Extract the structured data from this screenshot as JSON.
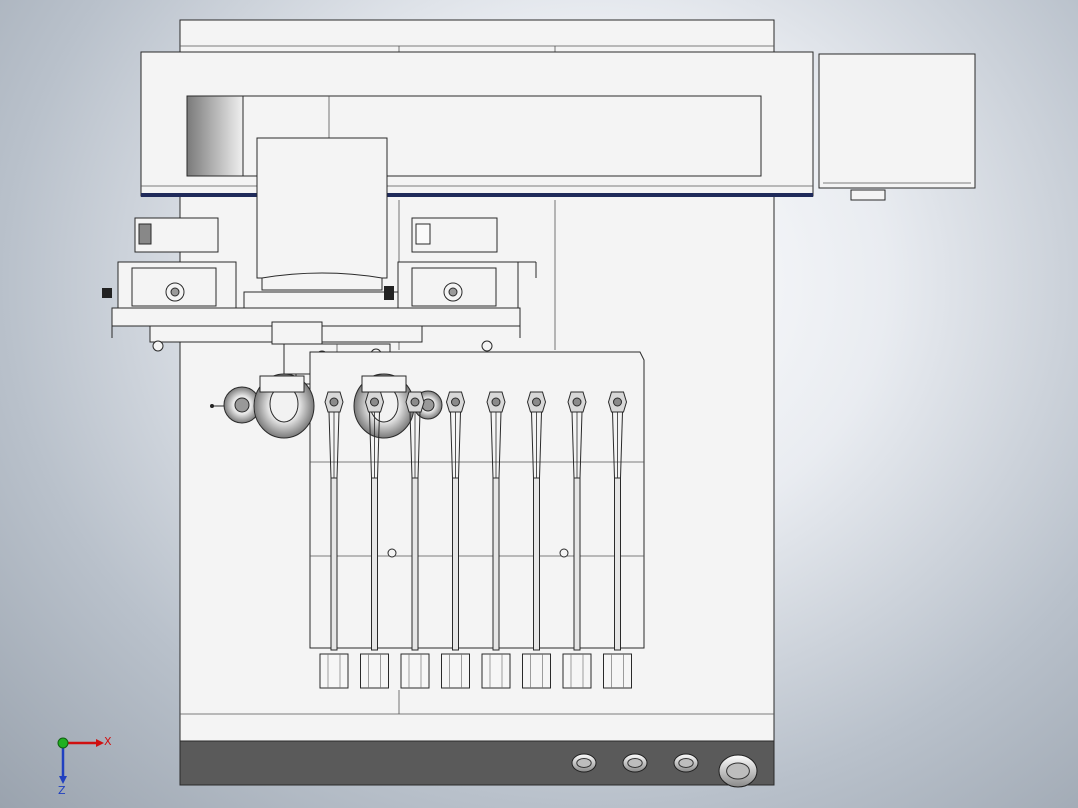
{
  "view": {
    "background_colors": {
      "center": "#ffffff",
      "edge": "#9aa3ae"
    },
    "highlight_color": "#a9a6d6",
    "trim_color": "#1f2a5a",
    "panel_color": "#5a5a5a"
  },
  "triad": {
    "x_label": "X",
    "z_label": "Z",
    "x_color": "#d01010",
    "y_color": "#20b020",
    "z_color": "#2040c0"
  },
  "machine": {
    "nozzle_count": 8,
    "front_knob_count": 4
  }
}
